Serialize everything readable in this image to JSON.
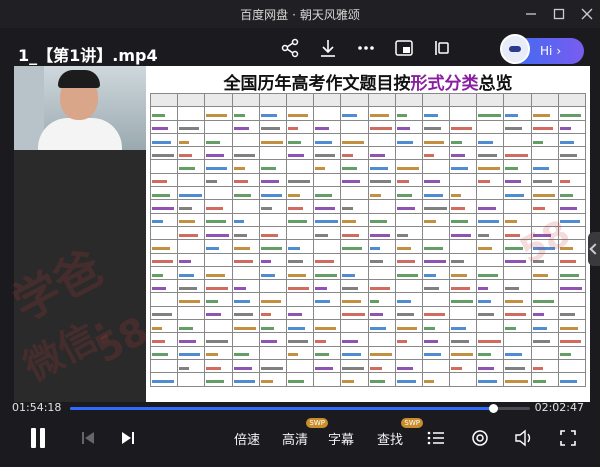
{
  "app": {
    "name": "百度网盘",
    "separator": "·",
    "subtitle": "朝天风雅颂"
  },
  "player": {
    "filename": "1_【第1讲】.mp4",
    "ai_label": "Hi",
    "current_time": "01:54:18",
    "total_time": "02:02:47",
    "progress": 0.92,
    "controls": {
      "speed": "倍速",
      "quality": "高清",
      "quality_badge": "SWP",
      "subtitle": "字幕",
      "search": "查找",
      "search_badge": "SWP"
    }
  },
  "slide": {
    "title_prefix": "全国历年高考作文题目按",
    "title_highlight": "形式分类",
    "title_suffix": "总览",
    "watermarks": [
      "学爸",
      "微信:",
      "58"
    ]
  },
  "colors": {
    "accent": "#2f6bff",
    "highlight": "#8a1ea0",
    "watermark": "#c83c3c"
  }
}
